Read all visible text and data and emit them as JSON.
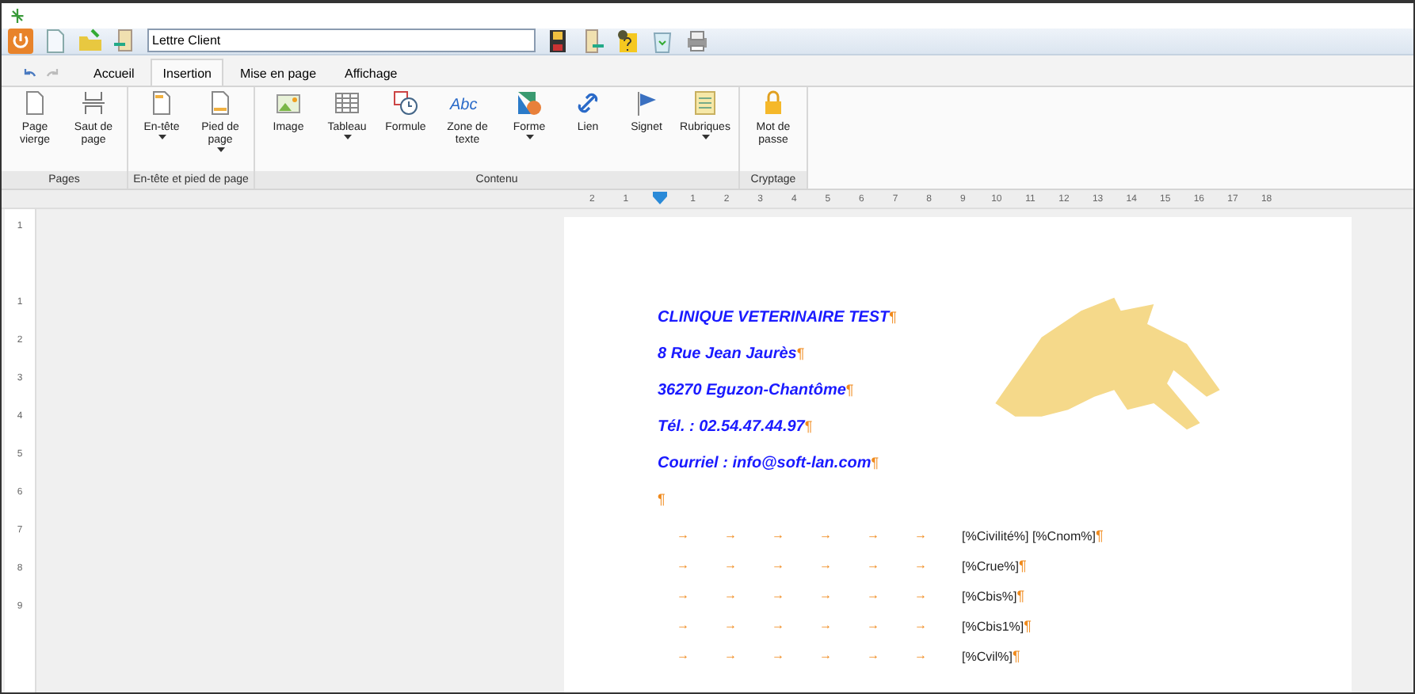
{
  "toolbar": {
    "document_name": "Lettre Client"
  },
  "tabs": [
    {
      "label": "Accueil",
      "selected": false
    },
    {
      "label": "Insertion",
      "selected": true
    },
    {
      "label": "Mise en page",
      "selected": false
    },
    {
      "label": "Affichage",
      "selected": false
    }
  ],
  "ribbon_groups": [
    {
      "label": "Pages",
      "buttons": [
        {
          "kind": "page",
          "label": "Page vierge",
          "dropdown": false
        },
        {
          "kind": "break",
          "label": "Saut de page",
          "dropdown": false
        }
      ]
    },
    {
      "label": "En-tête et pied de page",
      "buttons": [
        {
          "kind": "header",
          "label": "En-tête",
          "dropdown": true
        },
        {
          "kind": "footer",
          "label": "Pied de page",
          "dropdown": true
        }
      ]
    },
    {
      "label": "Contenu",
      "buttons": [
        {
          "kind": "image",
          "label": "Image",
          "dropdown": false
        },
        {
          "kind": "table",
          "label": "Tableau",
          "dropdown": true
        },
        {
          "kind": "formula",
          "label": "Formule",
          "dropdown": false
        },
        {
          "kind": "textbox",
          "label": "Zone de texte",
          "dropdown": false,
          "icon_text": "Abc"
        },
        {
          "kind": "shape",
          "label": "Forme",
          "dropdown": true
        },
        {
          "kind": "link",
          "label": "Lien",
          "dropdown": false
        },
        {
          "kind": "bookmark",
          "label": "Signet",
          "dropdown": false
        },
        {
          "kind": "fields",
          "label": "Rubriques",
          "dropdown": true
        }
      ]
    },
    {
      "label": "Cryptage",
      "buttons": [
        {
          "kind": "lock",
          "label": "Mot de passe",
          "dropdown": false
        }
      ]
    }
  ],
  "ruler": {
    "left_numbers": [
      "2",
      "1"
    ],
    "numbers": [
      "1",
      "2",
      "3",
      "4",
      "5",
      "6",
      "7",
      "8",
      "9",
      "10",
      "11",
      "12",
      "13",
      "14",
      "15",
      "16",
      "17",
      "18"
    ]
  },
  "vertical_ruler": {
    "top_numbers": [
      "1"
    ],
    "numbers": [
      "1",
      "2",
      "3",
      "4",
      "5",
      "6",
      "7",
      "8",
      "9"
    ]
  },
  "document": {
    "header_lines": [
      {
        "text": "CLINIQUE VETERINAIRE TEST",
        "mark": "¶"
      },
      {
        "text": "8 Rue Jean Jaurès",
        "mark": "¶"
      },
      {
        "text": "36270 Eguzon-Chantôme",
        "mark": "¶"
      },
      {
        "text": "Tél. : 02.54.47.44.97",
        "mark": "¶"
      },
      {
        "text": "Courriel : info@soft-lan.com",
        "mark": "¶"
      }
    ],
    "empty_mark": "¶",
    "address_lines": [
      {
        "tabs": [
          "→",
          "→",
          "→",
          "→",
          "→",
          "→"
        ],
        "text": "[%Civilité%] [%Cnom%]",
        "mark": "¶"
      },
      {
        "tabs": [
          "→",
          "→",
          "→",
          "→",
          "→",
          "→"
        ],
        "text": "[%Crue%]",
        "mark": "¶"
      },
      {
        "tabs": [
          "→",
          "→",
          "→",
          "→",
          "→",
          "→"
        ],
        "text": "[%Cbis%]",
        "mark": "¶"
      },
      {
        "tabs": [
          "→",
          "→",
          "→",
          "→",
          "→",
          "→"
        ],
        "text": "[%Cbis1%]",
        "mark": "¶"
      },
      {
        "tabs": [
          "→",
          "→",
          "→",
          "→",
          "→",
          "→"
        ],
        "text": "[%Cvil%]",
        "mark": "¶"
      }
    ]
  }
}
